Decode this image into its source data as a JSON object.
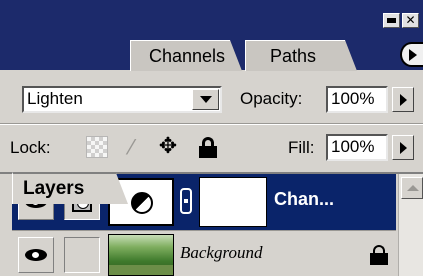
{
  "tabs": [
    {
      "label": "Layers",
      "active": true
    },
    {
      "label": "Channels",
      "active": false
    },
    {
      "label": "Paths",
      "active": false
    }
  ],
  "options": {
    "blend_mode": "Lighten",
    "opacity_label": "Opacity:",
    "opacity_value": "100%",
    "lock_label": "Lock:",
    "fill_label": "Fill:",
    "fill_value": "100%"
  },
  "layers": [
    {
      "name": "Chan...",
      "selected": true,
      "visible": true,
      "type": "adjustment"
    },
    {
      "name": "Background",
      "selected": false,
      "visible": true,
      "locked": true,
      "type": "image"
    }
  ],
  "colors": {
    "title_bar": "#1c2a6b",
    "selection": "#0a246a",
    "panel": "#d6d3ce"
  }
}
